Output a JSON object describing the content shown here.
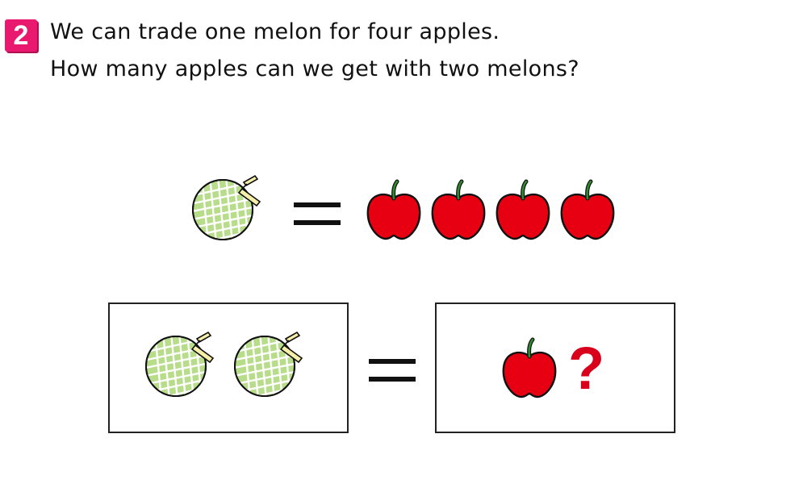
{
  "question": {
    "number": "2",
    "line1": "We can trade one melon for four apples.",
    "line2": "How many apples can we get with two melons?"
  },
  "equation_top": {
    "left": [
      {
        "item": "melon-icon"
      }
    ],
    "right": [
      {
        "item": "apple-icon"
      },
      {
        "item": "apple-icon"
      },
      {
        "item": "apple-icon"
      },
      {
        "item": "apple-icon"
      }
    ]
  },
  "equation_bottom": {
    "left": [
      {
        "item": "melon-icon"
      },
      {
        "item": "melon-icon"
      }
    ],
    "right": [
      {
        "item": "apple-icon"
      }
    ],
    "unknown": "?"
  },
  "colors": {
    "badge": "#e8196e",
    "melon_fill": "#b7dd8a",
    "melon_net": "#ffffff",
    "apple": "#e60012",
    "stem": "#2e8b2e",
    "question_mark": "#d9001b"
  }
}
